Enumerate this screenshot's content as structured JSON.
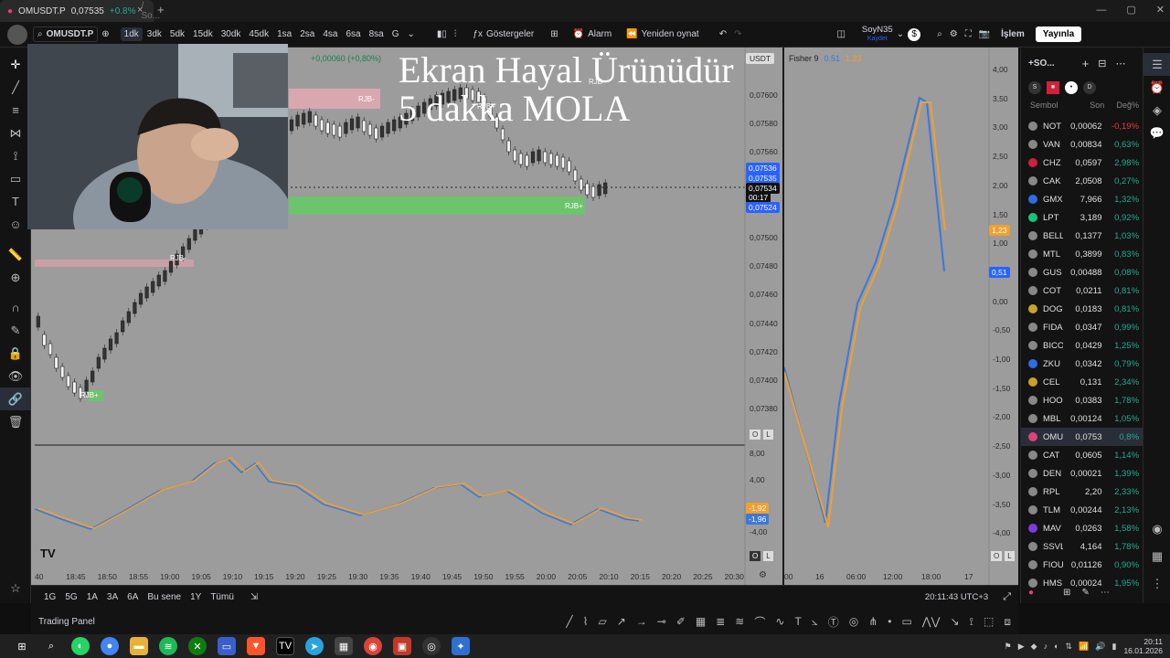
{
  "browser_tab": {
    "title": "OMUSDT.P",
    "price": "0,07535",
    "change": "+0.8%",
    "suffix": "/ So..."
  },
  "toolbar": {
    "symbol": "OMUSDT.P",
    "intervals": [
      "1dk",
      "3dk",
      "5dk",
      "15dk",
      "30dk",
      "45dk",
      "1sa",
      "2sa",
      "4sa",
      "6sa",
      "8sa",
      "G"
    ],
    "active_interval": "1dk",
    "indicators_label": "Göstergeler",
    "alarm_label": "Alarm",
    "replay_label": "Yeniden oynat",
    "layout_name": "SoyN35",
    "layout_status": "Kaydet",
    "trade_label": "İşlem",
    "publish_label": "Yayınla"
  },
  "overlay_text": "Ekran Hayal Ürünüdür\n5 dakka MOLA",
  "chart": {
    "legend_change": "+0,00060 (+0,80%)",
    "currency": "USDT",
    "rjb_labels": [
      "RJB-",
      "RJB-",
      "RJB-",
      "RJB+",
      "RJB+",
      "RJB+"
    ],
    "price_axis": [
      "0,07600",
      "0,07580",
      "0,07560",
      "0,07540",
      "0,07520",
      "0,07500",
      "0,07480",
      "0,07460",
      "0,07440",
      "0,07420",
      "0,07400",
      "0,07380"
    ],
    "price_tags": {
      "high": "0,07536",
      "last": "0,07535",
      "current": "0,07534",
      "countdown": "00:17",
      "low": "0,07524"
    },
    "osc_axis": [
      "8,00",
      "4,00",
      "0,00",
      "-4,00"
    ],
    "osc_tags": [
      "-1,92",
      "-1,96"
    ],
    "time_axis": [
      "40",
      "18:45",
      "18:50",
      "18:55",
      "19:00",
      "19:05",
      "19:10",
      "19:15",
      "19:20",
      "19:25",
      "19:30",
      "19:35",
      "19:40",
      "19:45",
      "19:50",
      "19:55",
      "20:00",
      "20:05",
      "20:10",
      "20:15",
      "20:20",
      "20:25",
      "20:30"
    ],
    "pane_buttons": [
      "O",
      "L"
    ]
  },
  "fisher": {
    "title": "Fisher 9",
    "value1": "0.51",
    "value2": "1.23",
    "axis": [
      "4,00",
      "3,50",
      "3,00",
      "2,50",
      "2,00",
      "1,50",
      "1,00",
      "0,50",
      "0,00",
      "-0,50",
      "-1,00",
      "-1,50",
      "-2,00",
      "-2,50",
      "-3,00",
      "-3,50",
      "-4,00"
    ],
    "tag_orange": "1,23",
    "tag_blue": "0,51",
    "time_axis": [
      "00",
      "16",
      "06:00",
      "12:00",
      "18:00",
      "17"
    ],
    "colors": {
      "fisher": "#3c78d8",
      "trigger": "#f0a030"
    }
  },
  "watchlist": {
    "title": "+SO...",
    "columns": [
      "Sembol",
      "Son",
      "Değ%"
    ],
    "rows": [
      {
        "sym": "NOT",
        "last": "0,00062",
        "chg": "-0,19%",
        "neg": true,
        "color": "#888"
      },
      {
        "sym": "VAN",
        "last": "0,00834",
        "chg": "0,63%",
        "color": "#888"
      },
      {
        "sym": "CHZ",
        "last": "0,0597",
        "chg": "2,98%",
        "color": "#d0213a"
      },
      {
        "sym": "CAK",
        "last": "2,0508",
        "chg": "0,27%",
        "color": "#888"
      },
      {
        "sym": "GMX",
        "last": "7,966",
        "chg": "1,32%",
        "color": "#2a6ee8"
      },
      {
        "sym": "LPT",
        "last": "3,189",
        "chg": "0,92%",
        "color": "#19c37d"
      },
      {
        "sym": "BELL",
        "last": "0,1377",
        "chg": "1,03%",
        "color": "#888"
      },
      {
        "sym": "MTL",
        "last": "0,3899",
        "chg": "0,83%",
        "color": "#888"
      },
      {
        "sym": "GUS",
        "last": "0,00488",
        "chg": "0,08%",
        "color": "#888"
      },
      {
        "sym": "COT",
        "last": "0,0211",
        "chg": "0,81%",
        "color": "#888"
      },
      {
        "sym": "DOG",
        "last": "0,0183",
        "chg": "0,81%",
        "color": "#c9a227"
      },
      {
        "sym": "FIDA",
        "last": "0,0347",
        "chg": "0,99%",
        "color": "#888"
      },
      {
        "sym": "BICO",
        "last": "0,0429",
        "chg": "1,25%",
        "color": "#888"
      },
      {
        "sym": "ZKU",
        "last": "0,0342",
        "chg": "0,79%",
        "color": "#2a6ee8"
      },
      {
        "sym": "CEL",
        "last": "0,131",
        "chg": "2,34%",
        "color": "#c9a227"
      },
      {
        "sym": "HOO",
        "last": "0,0383",
        "chg": "1,78%",
        "color": "#888"
      },
      {
        "sym": "MBL",
        "last": "0,00124",
        "chg": "1,05%",
        "color": "#888"
      },
      {
        "sym": "OMU",
        "last": "0,0753",
        "chg": "0,8%",
        "color": "#e0417d",
        "selected": true
      },
      {
        "sym": "CAT",
        "last": "0,0605",
        "chg": "1,14%",
        "color": "#888"
      },
      {
        "sym": "DEN",
        "last": "0,00021",
        "chg": "1,39%",
        "color": "#888"
      },
      {
        "sym": "RPL",
        "last": "2,20",
        "chg": "2,33%",
        "color": "#888"
      },
      {
        "sym": "TLM",
        "last": "0,00244",
        "chg": "2,13%",
        "color": "#888"
      },
      {
        "sym": "MAV",
        "last": "0,0263",
        "chg": "1,58%",
        "color": "#7a3ce0"
      },
      {
        "sym": "SSVL",
        "last": "4,164",
        "chg": "1,78%",
        "color": "#888"
      },
      {
        "sym": "FIOU",
        "last": "0,01126",
        "chg": "0,90%",
        "color": "#888"
      },
      {
        "sym": "HMS",
        "last": "0,00024",
        "chg": "1,95%",
        "color": "#888"
      }
    ]
  },
  "bottom": {
    "ranges": [
      "1G",
      "5G",
      "1A",
      "3A",
      "6A",
      "Bu sene",
      "1Y",
      "Tümü"
    ],
    "clock": "20:11:43 UTC+3",
    "panel_label": "Trading Panel"
  },
  "taskbar": {
    "time": "20:11",
    "date": "16.01.2026"
  }
}
